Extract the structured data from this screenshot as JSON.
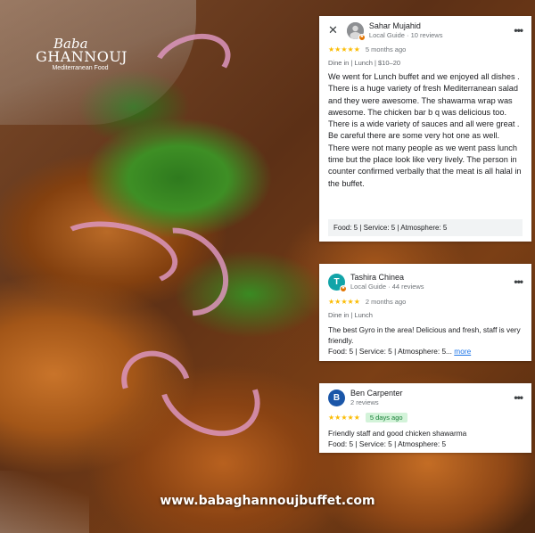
{
  "logo": {
    "script_text": "Baba",
    "brand_text": "GHANNOUJ",
    "tagline": "Mediterranean Food"
  },
  "reviews": [
    {
      "author": "Sahar Mujahid",
      "author_sub": "Local Guide · 10 reviews",
      "rating_stars": "★★★★★",
      "rating": 5,
      "time_ago": "5 months ago",
      "meta": "Dine in  |  Lunch  |  $10–20",
      "text": "We went for Lunch buffet and we enjoyed all dishes . There is a huge variety of fresh Mediterranean salad and they were awesome. The shawarma wrap was awesome. The chicken bar b q was delicious too. There is a wide variety of sauces and all were great . Be careful there are some very hot one as well. There were not many people as we went pass lunch time but the place look like very lively. The person in counter confirmed verbally that the meat is all halal in the buffet.",
      "ratings_line": "Food: 5  |  Service: 5  |  Atmosphere: 5",
      "avatar_color": "#9aa0a6"
    },
    {
      "author": "Tashira Chinea",
      "author_sub": "Local Guide · 44 reviews",
      "avatar_letter": "T",
      "rating_stars": "★★★★★",
      "rating": 5,
      "time_ago": "2 months ago",
      "meta": "Dine in  |  Lunch",
      "text": "The best Gyro in the area! Delicious and fresh, staff is very friendly.",
      "ratings_line": "Food: 5  |  Service: 5  |  Atmosphere: 5...",
      "more_label": "more",
      "avatar_color": "#12a4a8"
    },
    {
      "author": "Ben Carpenter",
      "author_sub": "2 reviews",
      "avatar_letter": "B",
      "rating_stars": "★★★★★",
      "rating": 5,
      "time_ago": "5 days ago",
      "text": "Friendly staff and good chicken shawarma",
      "ratings_line": "Food: 5  |  Service: 5  |  Atmosphere: 5",
      "avatar_color": "#1a56a8"
    }
  ],
  "icons": {
    "close": "close-icon",
    "more": "more-vert-icon",
    "star": "star-icon"
  },
  "colors": {
    "star": "#fbbc04",
    "new_badge_bg": "#d3f3d9",
    "new_badge_fg": "#188038",
    "link": "#1a73e8"
  },
  "website": "www.babaghannoujbuffet.com"
}
